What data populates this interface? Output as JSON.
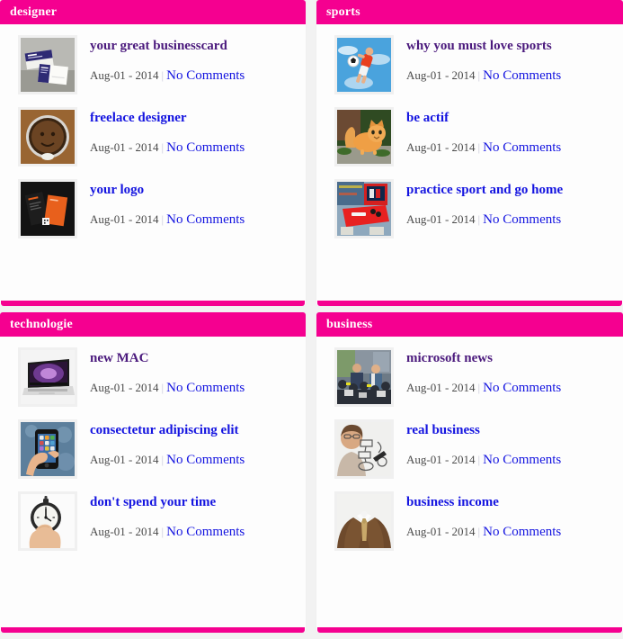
{
  "theme": {
    "accent": "#f50090",
    "panel_bg": "#fdfdfd",
    "page_bg": "#f2f2f2",
    "link": "#1414e0",
    "link_visited": "#4b1a7d",
    "meta_text": "#4a4a4a"
  },
  "panels": [
    {
      "title": "designer",
      "posts": [
        {
          "title": "your great businesscard",
          "date": "Aug-01 - 2014",
          "separator": "|",
          "comments": "No Comments",
          "visited": true,
          "thumb": "business-cards-thumbnail"
        },
        {
          "title": "freelace designer",
          "date": "Aug-01 - 2014",
          "separator": "|",
          "comments": "No Comments",
          "visited": false,
          "thumb": "coffee-cup-thumbnail"
        },
        {
          "title": "your logo",
          "date": "Aug-01 - 2014",
          "separator": "|",
          "comments": "No Comments",
          "visited": false,
          "thumb": "orange-branding-thumbnail"
        }
      ]
    },
    {
      "title": "sports",
      "posts": [
        {
          "title": "why you must love sports",
          "date": "Aug-01 - 2014",
          "separator": "|",
          "comments": "No Comments",
          "visited": true,
          "thumb": "soccer-player-sky-thumbnail"
        },
        {
          "title": "be actif",
          "date": "Aug-01 - 2014",
          "separator": "|",
          "comments": "No Comments",
          "visited": false,
          "thumb": "orange-cat-thumbnail"
        },
        {
          "title": "practice sport and go home",
          "date": "Aug-01 - 2014",
          "separator": "|",
          "comments": "No Comments",
          "visited": false,
          "thumb": "red-table-tv-thumbnail"
        }
      ]
    },
    {
      "title": "technologie",
      "posts": [
        {
          "title": "new MAC",
          "date": "Aug-01 - 2014",
          "separator": "|",
          "comments": "No Comments",
          "visited": true,
          "thumb": "macbook-laptop-thumbnail"
        },
        {
          "title": "consectetur adipiscing elit",
          "date": "Aug-01 - 2014",
          "separator": "|",
          "comments": "No Comments",
          "visited": false,
          "thumb": "smartphone-in-hand-thumbnail"
        },
        {
          "title": "don't spend your time",
          "date": "Aug-01 - 2014",
          "separator": "|",
          "comments": "No Comments",
          "visited": false,
          "thumb": "stopwatch-in-hand-thumbnail"
        }
      ]
    },
    {
      "title": "business",
      "posts": [
        {
          "title": "microsoft news",
          "date": "Aug-01 - 2014",
          "separator": "|",
          "comments": "No Comments",
          "visited": true,
          "thumb": "press-conference-crowd-thumbnail"
        },
        {
          "title": "real business",
          "date": "Aug-01 - 2014",
          "separator": "|",
          "comments": "No Comments",
          "visited": false,
          "thumb": "woman-whiteboard-diagram-thumbnail"
        },
        {
          "title": "business income",
          "date": "Aug-01 - 2014",
          "separator": "|",
          "comments": "No Comments",
          "visited": false,
          "thumb": "brown-suit-tie-thumbnail"
        }
      ]
    }
  ]
}
